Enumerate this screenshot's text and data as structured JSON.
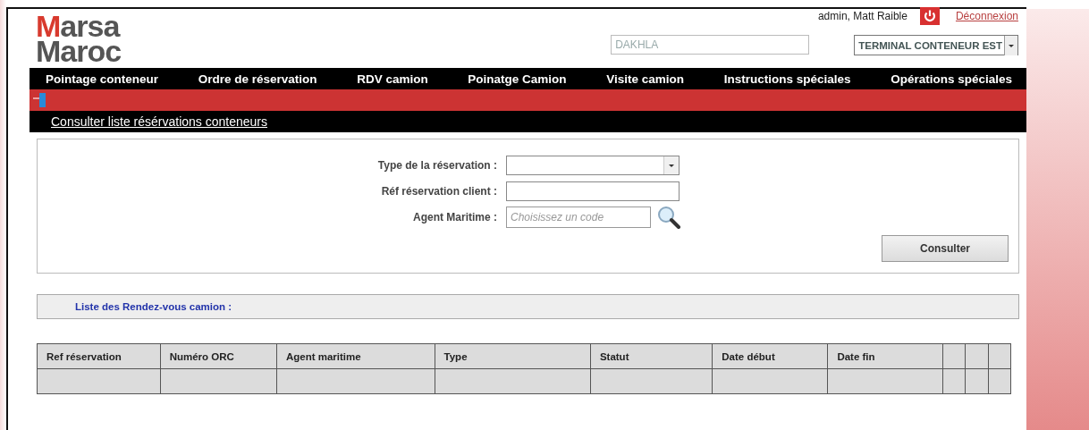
{
  "logo": {
    "line_1": "Marsa",
    "line_2": "Maroc"
  },
  "user": {
    "name": "admin, Matt Raible",
    "logout": "Déconnexion"
  },
  "site_field": {
    "value": "DAKHLA"
  },
  "terminal_select": {
    "value": "TERMINAL CONTENEUR EST"
  },
  "nav": [
    "Pointage conteneur",
    "Ordre de réservation",
    "RDV camion",
    "Poinatge Camion",
    "Visite camion",
    "Instructions spéciales",
    "Opérations spéciales"
  ],
  "page_title": "Consulter liste résérvations conteneurs",
  "form": {
    "fields": [
      {
        "kind": "select",
        "label": "Type de la réservation :"
      },
      {
        "kind": "text",
        "label": "Réf réservation client :"
      },
      {
        "kind": "lookup",
        "label": "Agent Maritime :",
        "placeholder": "Choisissez un code"
      }
    ],
    "submit": "Consulter"
  },
  "list_title": "Liste des Rendez-vous camion :",
  "table": {
    "columns": [
      "Ref réservation",
      "Numéro ORC",
      "Agent maritime",
      "Type",
      "Statut",
      "Date début",
      "Date fin"
    ]
  }
}
